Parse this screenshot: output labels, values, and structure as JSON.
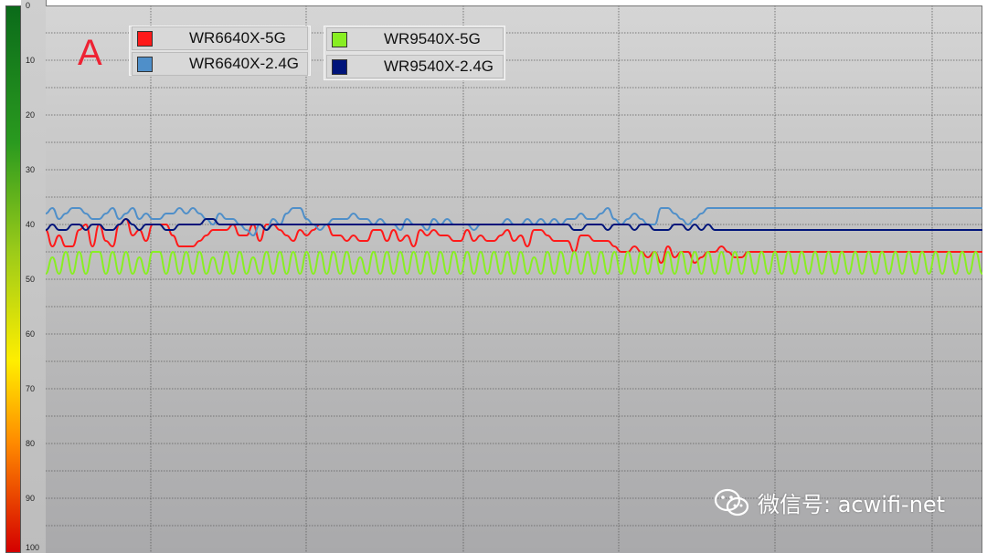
{
  "panel_label": "A",
  "watermark": {
    "text": "微信号: acwifi-net",
    "icon": "wechat-icon"
  },
  "colors": {
    "WR6640X-5G": "#ff1a1a",
    "WR6640X-2.4G": "#4f8fc9",
    "WR9540X-5G": "#88ee22",
    "WR9540X-2.4G": "#00147a"
  },
  "chart_data": {
    "type": "line",
    "title": "",
    "xlabel": "",
    "ylabel": "",
    "y_axis": {
      "inverted": true,
      "ylim": [
        0,
        100
      ],
      "ticks": [
        0,
        10,
        20,
        30,
        40,
        50,
        60,
        70,
        80,
        90,
        100
      ],
      "tick_labels": [
        "0",
        "10",
        "20",
        "30",
        "40",
        "50",
        "60",
        "70",
        "80",
        "90",
        "100"
      ]
    },
    "grid": true,
    "legend": {
      "placement": "top-left"
    },
    "x": [
      0,
      1,
      2,
      3,
      4,
      5,
      6,
      7,
      8,
      9,
      10,
      11,
      12,
      13,
      14,
      15,
      16,
      17,
      18,
      19,
      20,
      21,
      22,
      23,
      24,
      25,
      26,
      27,
      28,
      29,
      30,
      31,
      32,
      33,
      34,
      35,
      36,
      37,
      38,
      39,
      40,
      41,
      42,
      43,
      44,
      45,
      46,
      47,
      48,
      49,
      50,
      51,
      52,
      53,
      54,
      55,
      56,
      57,
      58,
      59,
      60,
      61,
      62,
      63,
      64,
      65,
      66,
      67,
      68,
      69,
      70,
      71,
      72,
      73,
      74,
      75,
      76,
      77,
      78,
      79,
      80,
      81,
      82,
      83,
      84,
      85,
      86,
      87,
      88,
      89,
      90,
      91,
      92,
      93,
      94,
      95,
      96,
      97,
      98,
      99,
      100,
      101,
      102,
      103,
      104,
      105,
      106,
      107,
      108,
      109,
      110,
      111,
      112,
      113,
      114,
      115,
      116,
      117,
      118,
      119,
      120,
      121,
      122,
      123,
      124,
      125,
      126,
      127,
      128,
      129,
      130,
      131,
      132,
      133,
      134,
      135,
      136,
      137,
      138,
      139,
      140
    ],
    "series": [
      {
        "name": "WR6640X-5G",
        "values": [
          41,
          44,
          42,
          44,
          44,
          41,
          40,
          44,
          40,
          43,
          44,
          40,
          39,
          42,
          41,
          43,
          40,
          40,
          40,
          42,
          44,
          44,
          44,
          43,
          42,
          41,
          41,
          41,
          40,
          42,
          42,
          40,
          43,
          40,
          40,
          41,
          42,
          43,
          41,
          42,
          41,
          40,
          40,
          42,
          42,
          43,
          42,
          43,
          43,
          41,
          41,
          43,
          41,
          43,
          42,
          44,
          41,
          42,
          41,
          42,
          42,
          43,
          43,
          41,
          43,
          42,
          43,
          43,
          42,
          41,
          43,
          42,
          44,
          41,
          41,
          42,
          43,
          43,
          43,
          45,
          42,
          42,
          43,
          43,
          43,
          44,
          45,
          45,
          44,
          45,
          46,
          45,
          47,
          44,
          46,
          45,
          45,
          47,
          46,
          45,
          45,
          44,
          45,
          46,
          46,
          45,
          45,
          45,
          45,
          45,
          45,
          45,
          45,
          45,
          45,
          45,
          45,
          45,
          45,
          45,
          45,
          45,
          45,
          45,
          45,
          45,
          45,
          45,
          45,
          45,
          45,
          45,
          45,
          45,
          45,
          45,
          45,
          45,
          45,
          45,
          45
        ]
      },
      {
        "name": "WR6640X-2.4G",
        "values": [
          38,
          37,
          39,
          38,
          37,
          37,
          38,
          39,
          39,
          38,
          37,
          39,
          38,
          37,
          39,
          38,
          39,
          39,
          38,
          38,
          37,
          38,
          37,
          38,
          39,
          40,
          38,
          39,
          39,
          40,
          41,
          42,
          40,
          41,
          39,
          40,
          38,
          37,
          37,
          39,
          40,
          41,
          40,
          39,
          39,
          39,
          38,
          39,
          39,
          40,
          39,
          40,
          40,
          41,
          39,
          40,
          40,
          41,
          39,
          40,
          39,
          40,
          40,
          40,
          41,
          40,
          40,
          40,
          40,
          39,
          40,
          40,
          39,
          40,
          39,
          40,
          39,
          40,
          39,
          39,
          38,
          39,
          39,
          38,
          37,
          39,
          40,
          39,
          38,
          39,
          40,
          40,
          37,
          37,
          38,
          39,
          40,
          39,
          38,
          37,
          37,
          37,
          37,
          37,
          37,
          37,
          37,
          37,
          37,
          37,
          37,
          37,
          37,
          37,
          37,
          37,
          37,
          37,
          37,
          37,
          37,
          37,
          37,
          37,
          37,
          37,
          37,
          37,
          37,
          37,
          37,
          37,
          37,
          37,
          37,
          37,
          37,
          37,
          37,
          37,
          37
        ]
      },
      {
        "name": "WR9540X-5G",
        "values": [
          49,
          46,
          49,
          45,
          49,
          45,
          49,
          45,
          45,
          49,
          45,
          49,
          45,
          49,
          46,
          49,
          45,
          45,
          49,
          45,
          49,
          45,
          49,
          45,
          49,
          46,
          49,
          45,
          49,
          45,
          49,
          46,
          49,
          45,
          49,
          45,
          49,
          45,
          49,
          45,
          49,
          45,
          49,
          45,
          49,
          45,
          49,
          46,
          49,
          45,
          49,
          45,
          49,
          45,
          49,
          45,
          49,
          45,
          49,
          45,
          49,
          45,
          49,
          45,
          49,
          45,
          49,
          45,
          49,
          45,
          49,
          45,
          49,
          46,
          49,
          45,
          49,
          45,
          49,
          45,
          49,
          45,
          49,
          45,
          49,
          45,
          49,
          45,
          49,
          45,
          49,
          45,
          49,
          45,
          49,
          45,
          49,
          45,
          49,
          45,
          49,
          45,
          49,
          45,
          49,
          45,
          49,
          45,
          49,
          45,
          49,
          45,
          49,
          45,
          49,
          45,
          49,
          45,
          49,
          45,
          49,
          45,
          49,
          45,
          49,
          45,
          49,
          45,
          49,
          45,
          49,
          45,
          49,
          45,
          49,
          45,
          49,
          45,
          49,
          45,
          49
        ]
      },
      {
        "name": "WR9540X-2.4G",
        "values": [
          41,
          40,
          41,
          41,
          40,
          40,
          41,
          40,
          40,
          41,
          41,
          40,
          39,
          40,
          41,
          40,
          40,
          40,
          41,
          41,
          40,
          40,
          40,
          40,
          39,
          39,
          40,
          40,
          40,
          40,
          40,
          40,
          40,
          41,
          40,
          40,
          40,
          40,
          40,
          40,
          40,
          40,
          40,
          40,
          40,
          40,
          40,
          40,
          40,
          40,
          40,
          40,
          40,
          40,
          40,
          40,
          40,
          40,
          40,
          40,
          40,
          40,
          40,
          40,
          40,
          40,
          40,
          40,
          40,
          40,
          40,
          40,
          40,
          40,
          40,
          40,
          40,
          40,
          40,
          41,
          41,
          40,
          40,
          40,
          41,
          40,
          40,
          40,
          41,
          40,
          40,
          41,
          41,
          41,
          40,
          40,
          41,
          40,
          41,
          40,
          41,
          41,
          41,
          41,
          41,
          41,
          41,
          41,
          41,
          41,
          41,
          41,
          41,
          41,
          41,
          41,
          41,
          41,
          41,
          41,
          41,
          41,
          41,
          41,
          41,
          41,
          41,
          41,
          41,
          41,
          41,
          41,
          41,
          41,
          41,
          41,
          41,
          41,
          41,
          41,
          41
        ]
      }
    ]
  }
}
